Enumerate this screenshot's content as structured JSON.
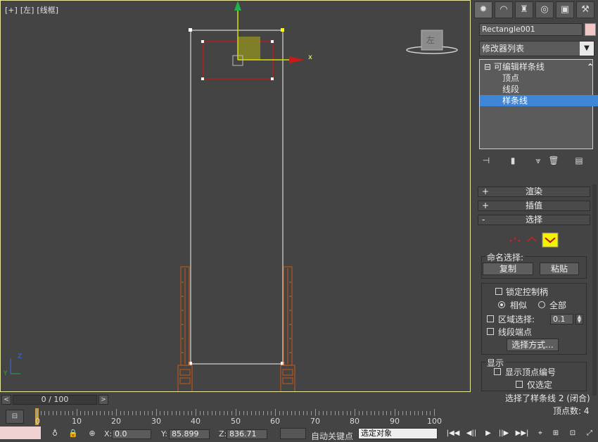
{
  "viewport": {
    "label_parts": [
      "[+]",
      "[左]",
      "[线框]"
    ],
    "viewcube_face": "左",
    "axis_x": "x",
    "gizmo_x": "Y",
    "gizmo_z": "Z"
  },
  "command_panel": {
    "tabs": [
      "create-icon",
      "modify-icon",
      "hierarchy-icon",
      "motion-icon",
      "display-icon",
      "utilities-icon"
    ],
    "object_name": "Rectangle001",
    "object_color": "#f2c7c7",
    "modifier_list": "修改器列表",
    "stack": {
      "root": "可编辑样条线",
      "items": [
        "顶点",
        "线段",
        "样条线"
      ],
      "selected": "样条线"
    },
    "rollouts": {
      "render": "渲染",
      "interpolation": "插值",
      "selection": "选择"
    },
    "selection": {
      "named_group": "命名选择:",
      "copy": "复制",
      "paste": "粘贴",
      "lock_handles": "锁定控制柄",
      "similar": "相似",
      "all": "全部",
      "area_select": "区域选择:",
      "area_value": "0.1",
      "segment_end": "线段端点",
      "select_by": "选择方式...",
      "display_group": "显示",
      "show_vertex_numbers": "显示顶点编号",
      "selected_only": "仅选定",
      "status_line": "选择了样条线 2 (闭合)",
      "vertex_count": "顶点数: 4"
    }
  },
  "timeline": {
    "frame_display": "0 / 100",
    "prev": "<",
    "next": ">",
    "ticks": [
      "0",
      "10",
      "20",
      "30",
      "40",
      "50",
      "60",
      "70",
      "80",
      "90",
      "100"
    ]
  },
  "status": {
    "x_label": "X:",
    "x_value": "0.0",
    "y_label": "Y:",
    "y_value": "85.899",
    "z_label": "Z:",
    "z_value": "836.71",
    "auto_key": "自动关键点",
    "selection_set": "选定对象"
  }
}
